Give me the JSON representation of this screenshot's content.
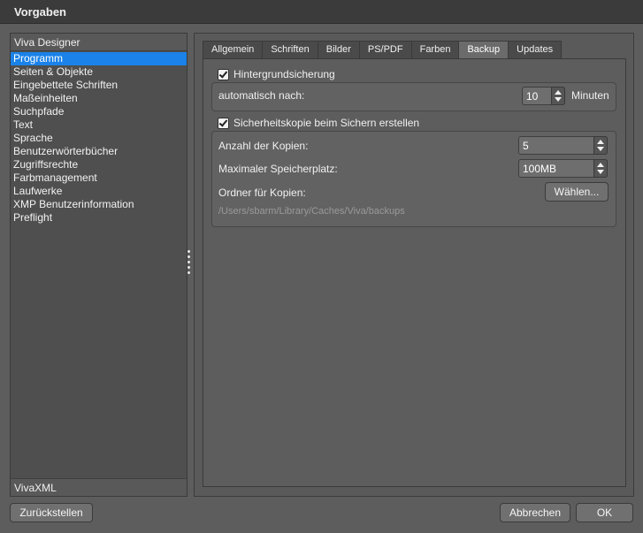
{
  "window": {
    "title": "Vorgaben"
  },
  "sidebar": {
    "header": "Viva Designer",
    "items": [
      "Programm",
      "Seiten & Objekte",
      "Eingebettete Schriften",
      "Maßeinheiten",
      "Suchpfade",
      "Text",
      "Sprache",
      "Benutzerwörterbücher",
      "Zugriffsrechte",
      "Farbmanagement",
      "Laufwerke",
      "XMP Benutzerinformation",
      "Preflight"
    ],
    "selected": "Programm",
    "footer": "VivaXML"
  },
  "tabs": [
    "Allgemein",
    "Schriften",
    "Bilder",
    "PS/PDF",
    "Farben",
    "Backup",
    "Updates"
  ],
  "active_tab": "Backup",
  "backup": {
    "background_save": {
      "label": "Hintergrundsicherung",
      "checked": true
    },
    "auto_after_label": "automatisch nach:",
    "auto_after_value": "10",
    "auto_after_unit": "Minuten",
    "safety_copy": {
      "label": "Sicherheitskopie beim Sichern erstellen",
      "checked": true
    },
    "copies_label": "Anzahl der Kopien:",
    "copies_value": "5",
    "max_storage_label": "Maximaler Speicherplatz:",
    "max_storage_value": "100MB",
    "folder_label": "Ordner für Kopien:",
    "choose_button": "Wählen...",
    "folder_path": "/Users/sbarm/Library/Caches/Viva/backups"
  },
  "footer": {
    "reset_button": "Zurückstellen",
    "cancel_button": "Abbrechen",
    "ok_button": "OK"
  },
  "colors": {
    "selection": "#1a82e8",
    "background": "#5d5d5d",
    "titlebar": "#3b3b3b"
  }
}
